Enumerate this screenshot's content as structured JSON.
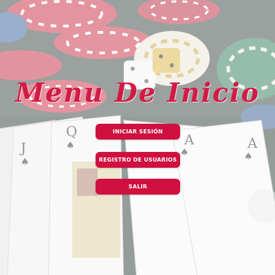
{
  "title": "Menu De Inicio",
  "buttons": {
    "login": "INICIAR SESIÓN",
    "register": "REGISTRO DE USUARIOS",
    "exit": "SALIR"
  },
  "colors": {
    "accent": "#d0103f",
    "title": "#d31a45",
    "button_text": "#ffffff"
  },
  "background": {
    "cards": [
      {
        "rank": "J",
        "suit": "spade-icon"
      },
      {
        "rank": "Q",
        "suit": "spade-icon"
      },
      {
        "rank": "A",
        "suit": "spade-icon"
      },
      {
        "rank": "A",
        "suit": "spade-icon"
      }
    ]
  }
}
